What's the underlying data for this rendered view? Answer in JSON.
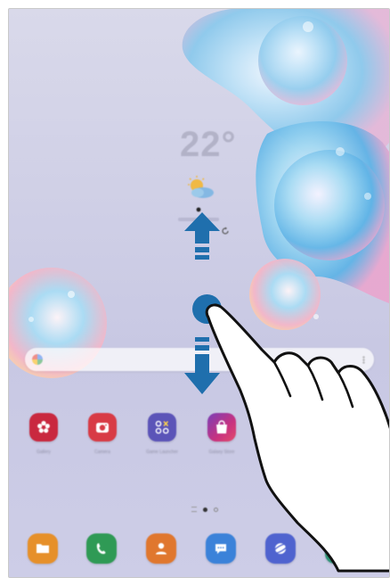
{
  "screen": {
    "clock": "22°",
    "colors": {
      "accent": "#1f6fad",
      "wallpaper": "#cfcfe6"
    }
  },
  "home_apps": [
    {
      "label": "Gallery",
      "icon": "gallery-flower-icon",
      "color": "#c9283f"
    },
    {
      "label": "Camera",
      "icon": "camera-icon",
      "color": "#d83b45"
    },
    {
      "label": "Game Launcher",
      "icon": "game-launcher-icon",
      "color": "#5b54b8"
    },
    {
      "label": "Galaxy Store",
      "icon": "galaxy-store-bag-icon",
      "color": "#c8327f"
    }
  ],
  "dock_apps": [
    {
      "label": "My Files",
      "icon": "folder-icon",
      "color": "#e6902a"
    },
    {
      "label": "Phone",
      "icon": "phone-icon",
      "color": "#2f9a55"
    },
    {
      "label": "Contacts",
      "icon": "contacts-icon",
      "color": "#e0772e"
    },
    {
      "label": "Messages",
      "icon": "messages-icon",
      "color": "#3b82d9"
    },
    {
      "label": "Internet",
      "icon": "internet-icon",
      "color": "#4f63cf"
    },
    {
      "label": "Calendar",
      "icon": "calendar-icon",
      "color": "#2a9274"
    }
  ],
  "gesture": {
    "type": "swipe-up-or-down",
    "arrow_up": "arrow-up-icon",
    "arrow_down": "arrow-down-icon",
    "hand": "pointing-hand-icon"
  }
}
